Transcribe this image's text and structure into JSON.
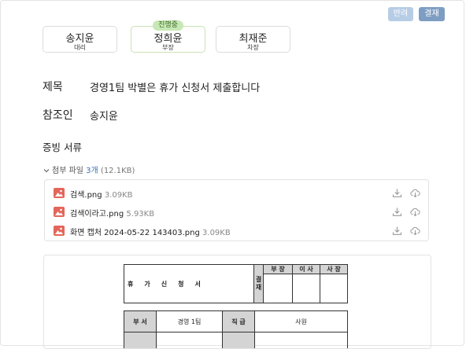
{
  "toolbar": {
    "reject_label": "반려",
    "approve_label": "결재"
  },
  "approval_line": [
    {
      "name": "송지윤",
      "rank": "대리"
    },
    {
      "name": "정희윤",
      "rank": "부장",
      "status": "진행중"
    },
    {
      "name": "최재준",
      "rank": "차장"
    }
  ],
  "fields": {
    "subject_label": "제목",
    "subject_value": "경영1팀 박별은 휴가 신청서 제출합니다",
    "cc_label": "참조인",
    "cc_value": "송지윤"
  },
  "evidence": {
    "title": "증빙 서류",
    "attach_label": "첨부 파일",
    "attach_count": "3개",
    "attach_total": "(12.1KB)",
    "files": [
      {
        "name": "검색.png",
        "size": "3.09KB"
      },
      {
        "name": "검색이라고.png",
        "size": "5.93KB"
      },
      {
        "name": "화면 캡처 2024-05-22 143403.png",
        "size": "3.09KB"
      }
    ]
  },
  "form": {
    "title": "휴가신청서",
    "approval_label": "결재",
    "approval_cols": [
      "부 장",
      "이 사",
      "사 장"
    ],
    "dept_label": "부 서",
    "dept_value": "경영 1팀",
    "position_label": "직 급",
    "position_value": "사원"
  }
}
